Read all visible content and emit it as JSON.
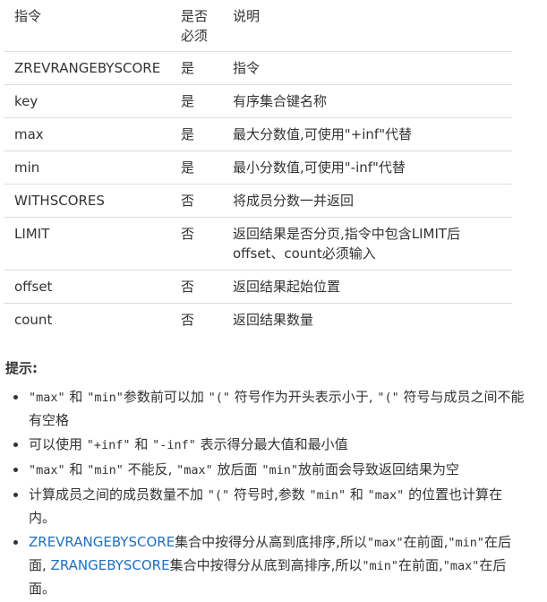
{
  "table": {
    "headers": [
      "指令",
      "是否必须",
      "说明"
    ],
    "rows": [
      {
        "name": "ZREVRANGEBYSCORE",
        "required": "是",
        "desc": "指令"
      },
      {
        "name": "key",
        "required": "是",
        "desc": "有序集合键名称"
      },
      {
        "name": "max",
        "required": "是",
        "desc": "最大分数值,可使用\"+inf\"代替"
      },
      {
        "name": "min",
        "required": "是",
        "desc": "最小分数值,可使用\"-inf\"代替"
      },
      {
        "name": "WITHSCORES",
        "required": "否",
        "desc": "将成员分数一并返回"
      },
      {
        "name": "LIMIT",
        "required": "否",
        "desc": "返回结果是否分页,指令中包含LIMIT后offset、count必须输入"
      },
      {
        "name": "offset",
        "required": "否",
        "desc": "返回结果起始位置"
      },
      {
        "name": "count",
        "required": "否",
        "desc": "返回结果数量"
      }
    ]
  },
  "tips": {
    "title": "提示:",
    "items": [
      {
        "t1": "\"max\"",
        "t2": " 和 ",
        "t3": "\"min\"",
        "t4": "参数前可以加 ",
        "t5": "\"(\"",
        "t6": " 符号作为开头表示小于, ",
        "t7": "\"(\"",
        "t8": " 符号与成员之间不能有空格"
      },
      {
        "t1": "可以使用 ",
        "t2": "\"+inf\"",
        "t3": " 和 ",
        "t4": "\"-inf\"",
        "t5": " 表示得分最大值和最小值"
      },
      {
        "t1": "\"max\"",
        "t2": " 和 ",
        "t3": "\"min\"",
        "t4": " 不能反, ",
        "t5": "\"max\"",
        "t6": " 放后面 ",
        "t7": "\"min\"",
        "t8": "放前面会导致返回结果为空"
      },
      {
        "t1": "计算成员之间的成员数量不加 ",
        "t2": "\"(\"",
        "t3": " 符号时,参数 ",
        "t4": "\"min\"",
        "t5": " 和 ",
        "t6": "\"max\"",
        "t7": " 的位置也计算在内。"
      },
      {
        "t1": "ZREVRANGEBYSCORE",
        "t2": "集合中按得分从高到底排序,所以",
        "t3": "\"max\"",
        "t4": "在前面,",
        "t5": "\"min\"",
        "t6": "在后面, ",
        "t7": "ZRANGEBYSCORE",
        "t8": "集合中按得分从底到高排序,所以",
        "t9": "\"min\"",
        "t10": "在前面,",
        "t11": "\"max\"",
        "t12": "在后面。"
      }
    ]
  },
  "colors": {
    "text": "#333333",
    "link": "#1e6fbf",
    "border": "#dddddd"
  }
}
